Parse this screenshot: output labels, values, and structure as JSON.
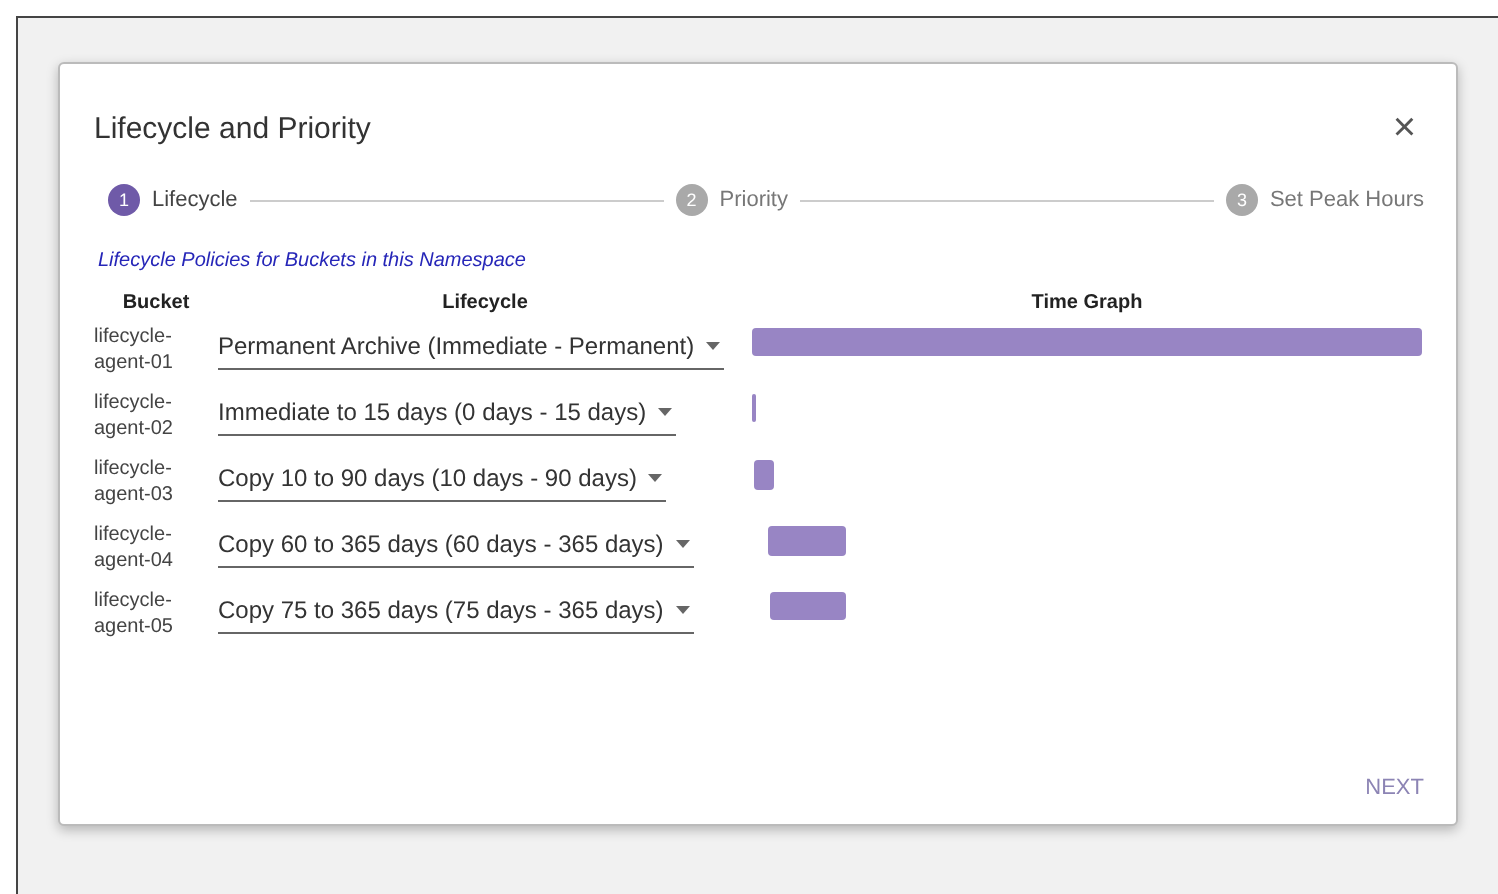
{
  "dialog": {
    "title": "Lifecycle and Priority",
    "close": "×"
  },
  "steps": [
    {
      "number": "1",
      "label": "Lifecycle",
      "selected": true
    },
    {
      "number": "2",
      "label": "Priority",
      "selected": false
    },
    {
      "number": "3",
      "label": "Set Peak Hours",
      "selected": false
    }
  ],
  "section_title": "Lifecycle Policies for Buckets in this Namespace",
  "table": {
    "columns": [
      "Bucket",
      "Lifecycle",
      "Time Graph"
    ],
    "rows": [
      {
        "bucket": "lifecycle-agent-01",
        "lifecycle": "Permanent Archive (Immediate - Permanent)"
      },
      {
        "bucket": "lifecycle-agent-02",
        "lifecycle": "Immediate to 15 days (0 days - 15 days)"
      },
      {
        "bucket": "lifecycle-agent-03",
        "lifecycle": "Copy 10 to 90 days (10 days - 90 days)"
      },
      {
        "bucket": "lifecycle-agent-04",
        "lifecycle": "Copy 60 to 365 days (60 days - 365 days)"
      },
      {
        "bucket": "lifecycle-agent-05",
        "lifecycle": "Copy 75 to 365 days (75 days - 365 days)"
      }
    ]
  },
  "buttons": [
    {
      "label": "NEXT"
    }
  ]
}
